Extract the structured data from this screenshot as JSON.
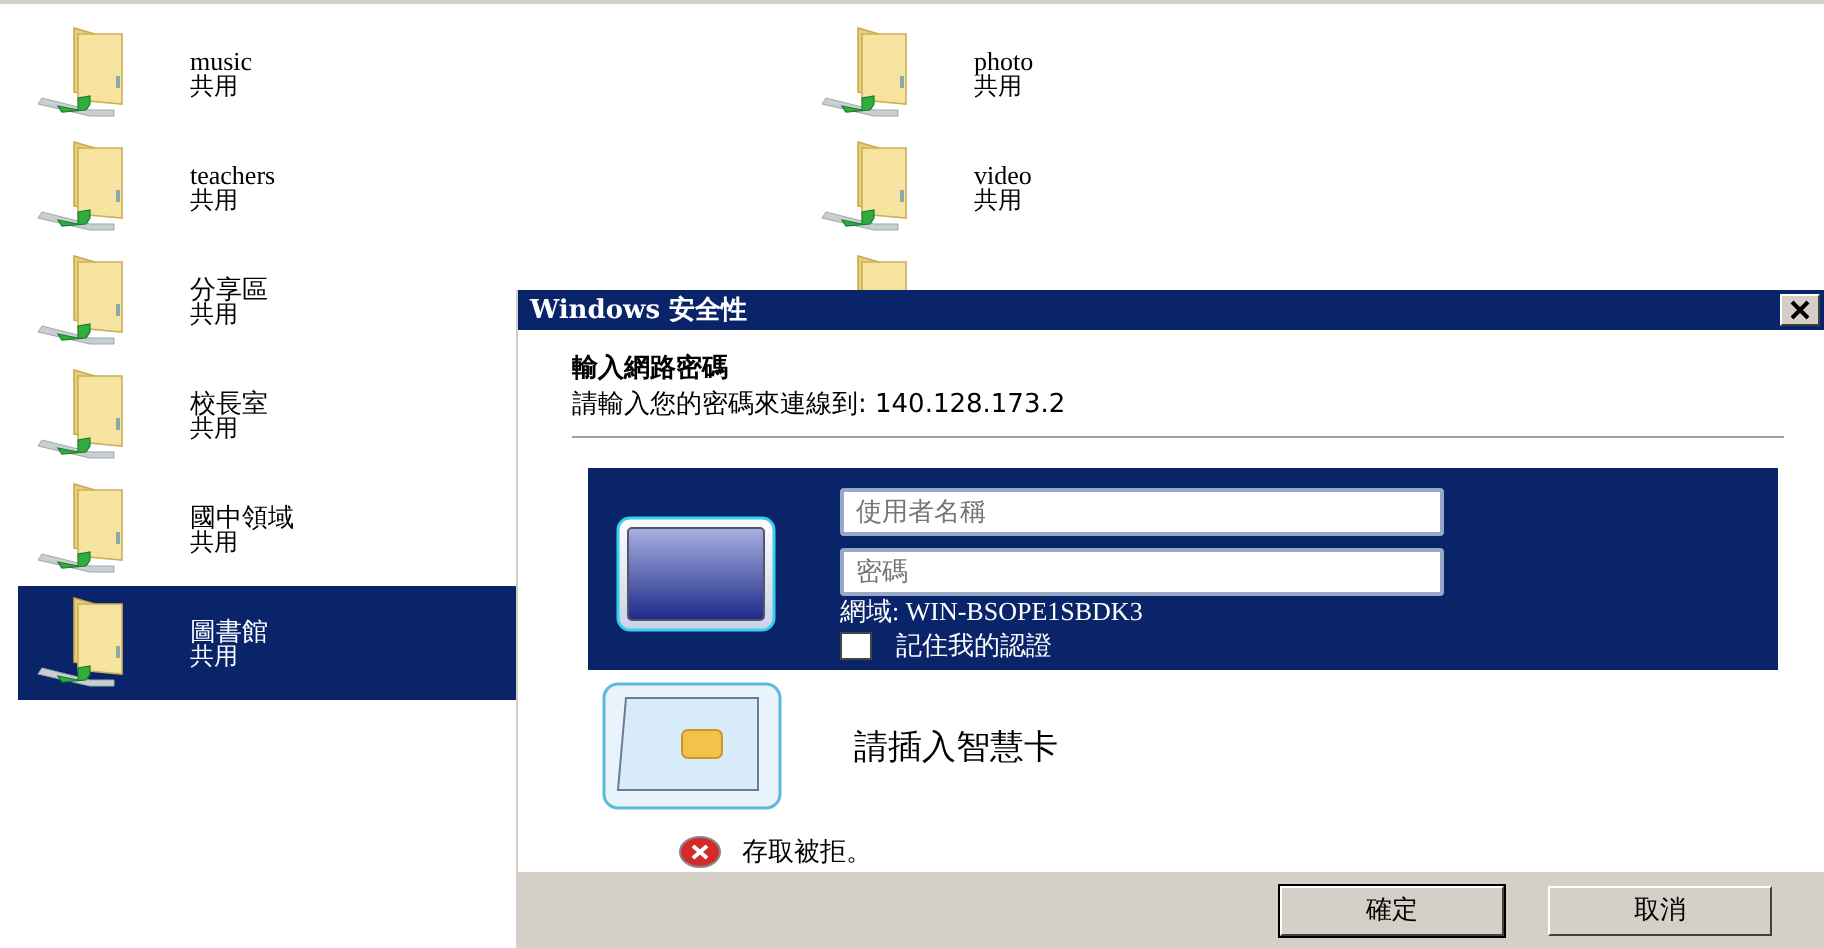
{
  "left_folders": [
    {
      "name": "music",
      "status": "共用",
      "selected": false
    },
    {
      "name": "teachers",
      "status": "共用",
      "selected": false
    },
    {
      "name": "分享區",
      "status": "共用",
      "selected": false
    },
    {
      "name": "校長室",
      "status": "共用",
      "selected": false
    },
    {
      "name": "國中領域",
      "status": "共用",
      "selected": false
    },
    {
      "name": "圖書館",
      "status": "共用",
      "selected": true
    }
  ],
  "right_folders": [
    {
      "name": "photo",
      "status": "共用",
      "selected": false
    },
    {
      "name": "video",
      "status": "共用",
      "selected": false
    }
  ],
  "dialog": {
    "title": "Windows 安全性",
    "heading": "輸入網路密碼",
    "subtitle": "請輸入您的密碼來連線到: 140.128.173.2",
    "username": {
      "placeholder": "使用者名稱"
    },
    "password": {
      "placeholder": "密碼"
    },
    "domain": "網域: WIN-BSOPE1SBDK3",
    "remember": {
      "label": "記住我的認證",
      "checked": false
    },
    "smartcard": "請插入智慧卡",
    "error": "存取被拒。",
    "buttons": [
      {
        "label": "確定",
        "default": true
      },
      {
        "label": "取消",
        "default": false
      }
    ]
  }
}
